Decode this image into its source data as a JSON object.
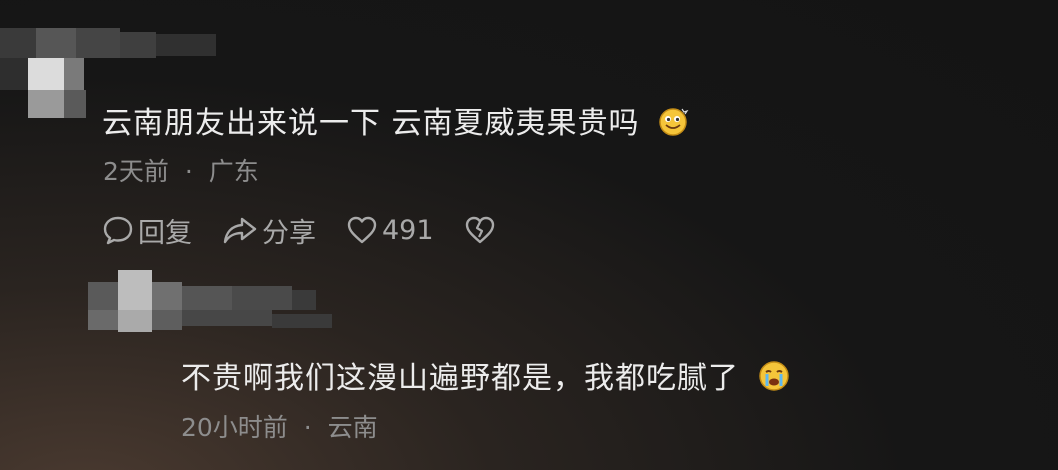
{
  "comment": {
    "text": "云南朋友出来说一下 云南夏威夷果贵吗",
    "emoji_icon": "smile-emoji",
    "time": "2天前",
    "location": "广东",
    "separator": "·",
    "actions": {
      "reply_label": "回复",
      "share_label": "分享",
      "like_count": "491"
    }
  },
  "reply": {
    "text": "不贵啊我们这漫山遍野都是，我都吃腻了",
    "emoji_icon": "crying-emoji",
    "time": "20小时前",
    "location": "云南",
    "separator": "·"
  }
}
